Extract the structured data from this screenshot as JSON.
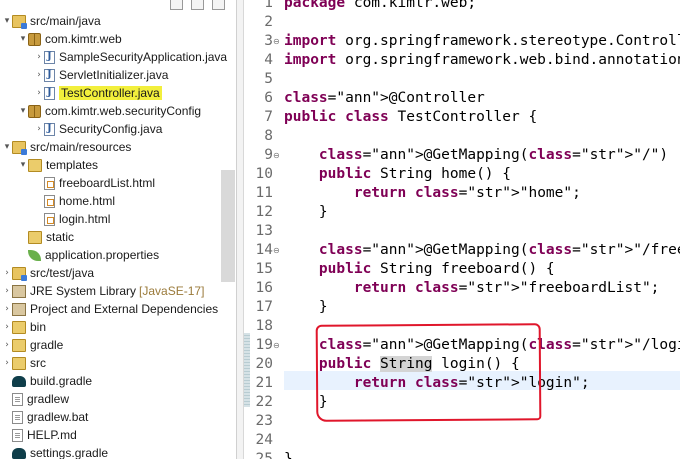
{
  "explorer": {
    "items": [
      {
        "label": "src/main/java",
        "icon": "source-folder-icon",
        "arrow": "▾",
        "indent": 0
      },
      {
        "label": "com.kimtr.web",
        "icon": "package-icon",
        "arrow": "▾",
        "indent": 1
      },
      {
        "label": "SampleSecurityApplication.java",
        "icon": "java-file-icon",
        "arrow": "›",
        "indent": 2
      },
      {
        "label": "ServletInitializer.java",
        "icon": "java-file-icon",
        "arrow": "›",
        "indent": 2
      },
      {
        "label": "TestController.java",
        "icon": "java-file-icon",
        "arrow": "›",
        "indent": 2,
        "highlight": true
      },
      {
        "label": "com.kimtr.web.securityConfig",
        "icon": "package-icon",
        "arrow": "▾",
        "indent": 1
      },
      {
        "label": "SecurityConfig.java",
        "icon": "java-file-icon",
        "arrow": "›",
        "indent": 2
      },
      {
        "label": "src/main/resources",
        "icon": "source-folder-icon",
        "arrow": "▾",
        "indent": 0
      },
      {
        "label": "templates",
        "icon": "folder-icon",
        "arrow": "▾",
        "indent": 1
      },
      {
        "label": "freeboardList.html",
        "icon": "html-file-icon",
        "arrow": "",
        "indent": 2
      },
      {
        "label": "home.html",
        "icon": "html-file-icon",
        "arrow": "",
        "indent": 2
      },
      {
        "label": "login.html",
        "icon": "html-file-icon",
        "arrow": "",
        "indent": 2
      },
      {
        "label": "static",
        "icon": "folder-icon",
        "arrow": "",
        "indent": 1
      },
      {
        "label": "application.properties",
        "icon": "properties-leaf-icon",
        "arrow": "",
        "indent": 1
      },
      {
        "label": "src/test/java",
        "icon": "source-folder-icon",
        "arrow": "›",
        "indent": 0
      },
      {
        "label": "JRE System Library",
        "decoration": "[JavaSE-17]",
        "icon": "library-icon",
        "arrow": "›",
        "indent": 0
      },
      {
        "label": "Project and External Dependencies",
        "icon": "library-icon",
        "arrow": "›",
        "indent": 0
      },
      {
        "label": "bin",
        "icon": "folder-icon",
        "arrow": "›",
        "indent": 0
      },
      {
        "label": "gradle",
        "icon": "folder-icon",
        "arrow": "›",
        "indent": 0
      },
      {
        "label": "src",
        "icon": "folder-icon",
        "arrow": "›",
        "indent": 0
      },
      {
        "label": "build.gradle",
        "icon": "gradle-elephant-icon",
        "arrow": "",
        "indent": 0
      },
      {
        "label": "gradlew",
        "icon": "file-icon",
        "arrow": "",
        "indent": 0
      },
      {
        "label": "gradlew.bat",
        "icon": "file-icon",
        "arrow": "",
        "indent": 0
      },
      {
        "label": "HELP.md",
        "icon": "markdown-file-icon",
        "arrow": "",
        "indent": 0
      },
      {
        "label": "settings.gradle",
        "icon": "gradle-elephant-icon",
        "arrow": "",
        "indent": 0
      }
    ]
  },
  "editor": {
    "lines": [
      {
        "n": "1",
        "text": "package com.kimtr.web;"
      },
      {
        "n": "2",
        "text": ""
      },
      {
        "n": "3",
        "text": "import org.springframework.stereotype.Controller;",
        "fold": "⊖"
      },
      {
        "n": "4",
        "text": "import org.springframework.web.bind.annotation.GetMapping;"
      },
      {
        "n": "5",
        "text": ""
      },
      {
        "n": "6",
        "text": "@Controller"
      },
      {
        "n": "7",
        "text": "public class TestController {"
      },
      {
        "n": "8",
        "text": ""
      },
      {
        "n": "9",
        "text": "    @GetMapping(\"/\")",
        "fold": "⊖"
      },
      {
        "n": "10",
        "text": "    public String home() {"
      },
      {
        "n": "11",
        "text": "        return \"home\";"
      },
      {
        "n": "12",
        "text": "    }"
      },
      {
        "n": "13",
        "text": ""
      },
      {
        "n": "14",
        "text": "    @GetMapping(\"/freeboard\")",
        "fold": "⊖"
      },
      {
        "n": "15",
        "text": "    public String freeboard() {"
      },
      {
        "n": "16",
        "text": "        return \"freeboardList\";"
      },
      {
        "n": "17",
        "text": "    }"
      },
      {
        "n": "18",
        "text": ""
      },
      {
        "n": "19",
        "text": "    @GetMapping(\"/login\")",
        "fold": "⊖"
      },
      {
        "n": "20",
        "text": "    public String login() {"
      },
      {
        "n": "21",
        "text": "        return \"login\";"
      },
      {
        "n": "22",
        "text": "    }"
      },
      {
        "n": "23",
        "text": ""
      },
      {
        "n": "24",
        "text": ""
      },
      {
        "n": "25",
        "text": "}"
      }
    ]
  },
  "colors": {
    "keyword": "#7f0055",
    "string": "#2a00ff",
    "annotation": "#646464",
    "highlight": "#f2ef3c",
    "annotation_box": "#e0162b"
  }
}
